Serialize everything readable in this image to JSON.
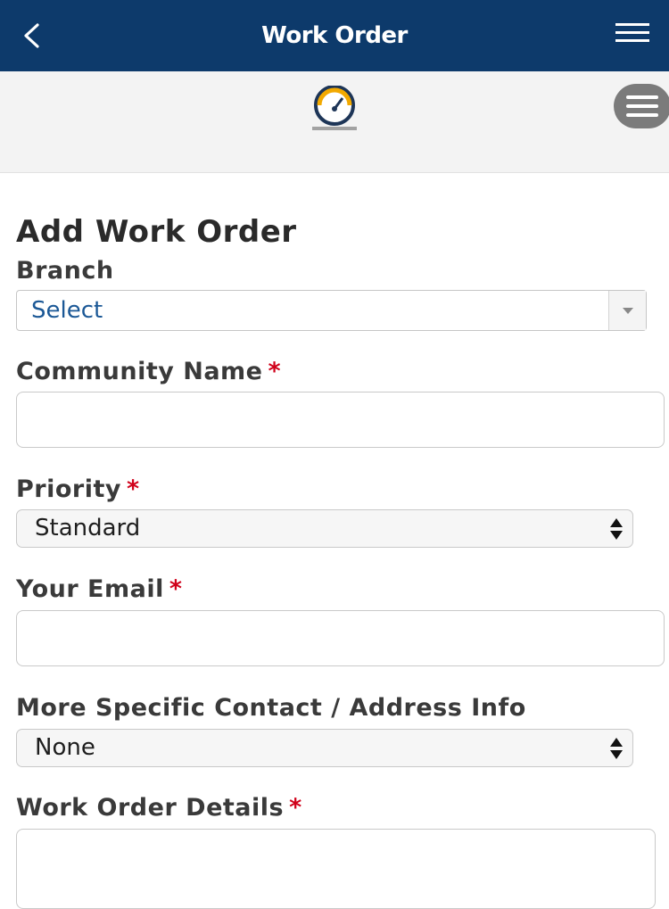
{
  "header": {
    "title": "Work Order",
    "back_icon": "chevron-left-icon",
    "menu_icon": "hamburger-icon",
    "bg_color": "#0d3a6b"
  },
  "banner": {
    "logo_icon": "speedometer-logo",
    "menu_icon": "circle-hamburger-icon"
  },
  "form": {
    "heading": "Add Work Order",
    "branch": {
      "label": "Branch",
      "value": "Select"
    },
    "community_name": {
      "label": "Community Name",
      "required_mark": "*",
      "value": ""
    },
    "priority": {
      "label": "Priority",
      "required_mark": "*",
      "value": "Standard"
    },
    "email": {
      "label": "Your Email",
      "required_mark": "*",
      "value": ""
    },
    "contact_info": {
      "label": "More Specific Contact / Address Info",
      "value": "None"
    },
    "details": {
      "label": "Work Order Details",
      "required_mark": "*",
      "value": ""
    }
  }
}
